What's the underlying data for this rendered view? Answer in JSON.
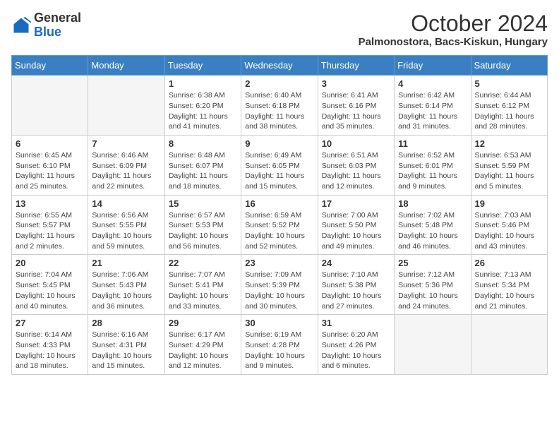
{
  "header": {
    "logo_general": "General",
    "logo_blue": "Blue",
    "main_title": "October 2024",
    "subtitle": "Palmonostora, Bacs-Kiskun, Hungary"
  },
  "days_of_week": [
    "Sunday",
    "Monday",
    "Tuesday",
    "Wednesday",
    "Thursday",
    "Friday",
    "Saturday"
  ],
  "weeks": [
    [
      {
        "day": "",
        "info": ""
      },
      {
        "day": "",
        "info": ""
      },
      {
        "day": "1",
        "info": "Sunrise: 6:38 AM\nSunset: 6:20 PM\nDaylight: 11 hours and 41 minutes."
      },
      {
        "day": "2",
        "info": "Sunrise: 6:40 AM\nSunset: 6:18 PM\nDaylight: 11 hours and 38 minutes."
      },
      {
        "day": "3",
        "info": "Sunrise: 6:41 AM\nSunset: 6:16 PM\nDaylight: 11 hours and 35 minutes."
      },
      {
        "day": "4",
        "info": "Sunrise: 6:42 AM\nSunset: 6:14 PM\nDaylight: 11 hours and 31 minutes."
      },
      {
        "day": "5",
        "info": "Sunrise: 6:44 AM\nSunset: 6:12 PM\nDaylight: 11 hours and 28 minutes."
      }
    ],
    [
      {
        "day": "6",
        "info": "Sunrise: 6:45 AM\nSunset: 6:10 PM\nDaylight: 11 hours and 25 minutes."
      },
      {
        "day": "7",
        "info": "Sunrise: 6:46 AM\nSunset: 6:09 PM\nDaylight: 11 hours and 22 minutes."
      },
      {
        "day": "8",
        "info": "Sunrise: 6:48 AM\nSunset: 6:07 PM\nDaylight: 11 hours and 18 minutes."
      },
      {
        "day": "9",
        "info": "Sunrise: 6:49 AM\nSunset: 6:05 PM\nDaylight: 11 hours and 15 minutes."
      },
      {
        "day": "10",
        "info": "Sunrise: 6:51 AM\nSunset: 6:03 PM\nDaylight: 11 hours and 12 minutes."
      },
      {
        "day": "11",
        "info": "Sunrise: 6:52 AM\nSunset: 6:01 PM\nDaylight: 11 hours and 9 minutes."
      },
      {
        "day": "12",
        "info": "Sunrise: 6:53 AM\nSunset: 5:59 PM\nDaylight: 11 hours and 5 minutes."
      }
    ],
    [
      {
        "day": "13",
        "info": "Sunrise: 6:55 AM\nSunset: 5:57 PM\nDaylight: 11 hours and 2 minutes."
      },
      {
        "day": "14",
        "info": "Sunrise: 6:56 AM\nSunset: 5:55 PM\nDaylight: 10 hours and 59 minutes."
      },
      {
        "day": "15",
        "info": "Sunrise: 6:57 AM\nSunset: 5:53 PM\nDaylight: 10 hours and 56 minutes."
      },
      {
        "day": "16",
        "info": "Sunrise: 6:59 AM\nSunset: 5:52 PM\nDaylight: 10 hours and 52 minutes."
      },
      {
        "day": "17",
        "info": "Sunrise: 7:00 AM\nSunset: 5:50 PM\nDaylight: 10 hours and 49 minutes."
      },
      {
        "day": "18",
        "info": "Sunrise: 7:02 AM\nSunset: 5:48 PM\nDaylight: 10 hours and 46 minutes."
      },
      {
        "day": "19",
        "info": "Sunrise: 7:03 AM\nSunset: 5:46 PM\nDaylight: 10 hours and 43 minutes."
      }
    ],
    [
      {
        "day": "20",
        "info": "Sunrise: 7:04 AM\nSunset: 5:45 PM\nDaylight: 10 hours and 40 minutes."
      },
      {
        "day": "21",
        "info": "Sunrise: 7:06 AM\nSunset: 5:43 PM\nDaylight: 10 hours and 36 minutes."
      },
      {
        "day": "22",
        "info": "Sunrise: 7:07 AM\nSunset: 5:41 PM\nDaylight: 10 hours and 33 minutes."
      },
      {
        "day": "23",
        "info": "Sunrise: 7:09 AM\nSunset: 5:39 PM\nDaylight: 10 hours and 30 minutes."
      },
      {
        "day": "24",
        "info": "Sunrise: 7:10 AM\nSunset: 5:38 PM\nDaylight: 10 hours and 27 minutes."
      },
      {
        "day": "25",
        "info": "Sunrise: 7:12 AM\nSunset: 5:36 PM\nDaylight: 10 hours and 24 minutes."
      },
      {
        "day": "26",
        "info": "Sunrise: 7:13 AM\nSunset: 5:34 PM\nDaylight: 10 hours and 21 minutes."
      }
    ],
    [
      {
        "day": "27",
        "info": "Sunrise: 6:14 AM\nSunset: 4:33 PM\nDaylight: 10 hours and 18 minutes."
      },
      {
        "day": "28",
        "info": "Sunrise: 6:16 AM\nSunset: 4:31 PM\nDaylight: 10 hours and 15 minutes."
      },
      {
        "day": "29",
        "info": "Sunrise: 6:17 AM\nSunset: 4:29 PM\nDaylight: 10 hours and 12 minutes."
      },
      {
        "day": "30",
        "info": "Sunrise: 6:19 AM\nSunset: 4:28 PM\nDaylight: 10 hours and 9 minutes."
      },
      {
        "day": "31",
        "info": "Sunrise: 6:20 AM\nSunset: 4:26 PM\nDaylight: 10 hours and 6 minutes."
      },
      {
        "day": "",
        "info": ""
      },
      {
        "day": "",
        "info": ""
      }
    ]
  ]
}
